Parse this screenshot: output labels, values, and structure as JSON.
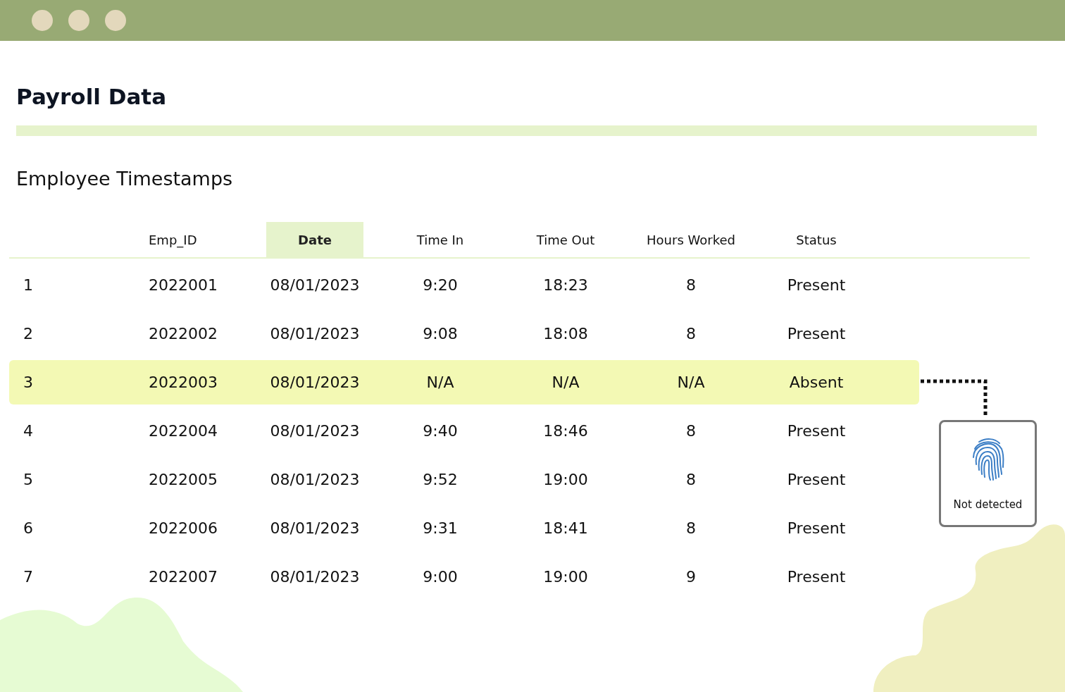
{
  "page": {
    "title": "Payroll Data",
    "section_title": "Employee Timestamps"
  },
  "table": {
    "columns": [
      {
        "label": "Emp_ID",
        "selected": false
      },
      {
        "label": "Date",
        "selected": true
      },
      {
        "label": "Time In",
        "selected": false
      },
      {
        "label": "Time Out",
        "selected": false
      },
      {
        "label": "Hours Worked",
        "selected": false
      },
      {
        "label": "Status",
        "selected": false
      }
    ],
    "rows": [
      {
        "number": "1",
        "cells": [
          "2022001",
          "08/01/2023",
          "9:20",
          "18:23",
          "8",
          "Present"
        ],
        "selected": false
      },
      {
        "number": "2",
        "cells": [
          "2022002",
          "08/01/2023",
          "9:08",
          "18:08",
          "8",
          "Present"
        ],
        "selected": false
      },
      {
        "number": "3",
        "cells": [
          "2022003",
          "08/01/2023",
          "N/A",
          "N/A",
          "N/A",
          "Absent"
        ],
        "selected": true
      },
      {
        "number": "4",
        "cells": [
          "2022004",
          "08/01/2023",
          "9:40",
          "18:46",
          "8",
          "Present"
        ],
        "selected": false
      },
      {
        "number": "5",
        "cells": [
          "2022005",
          "08/01/2023",
          "9:52",
          "19:00",
          "8",
          "Present"
        ],
        "selected": false
      },
      {
        "number": "6",
        "cells": [
          "2022006",
          "08/01/2023",
          "9:31",
          "18:41",
          "8",
          "Present"
        ],
        "selected": false
      },
      {
        "number": "7",
        "cells": [
          "2022007",
          "08/01/2023",
          "9:00",
          "19:00",
          "9",
          "Present"
        ],
        "selected": false
      }
    ]
  },
  "scanner_card": {
    "label": "Not detected"
  }
}
